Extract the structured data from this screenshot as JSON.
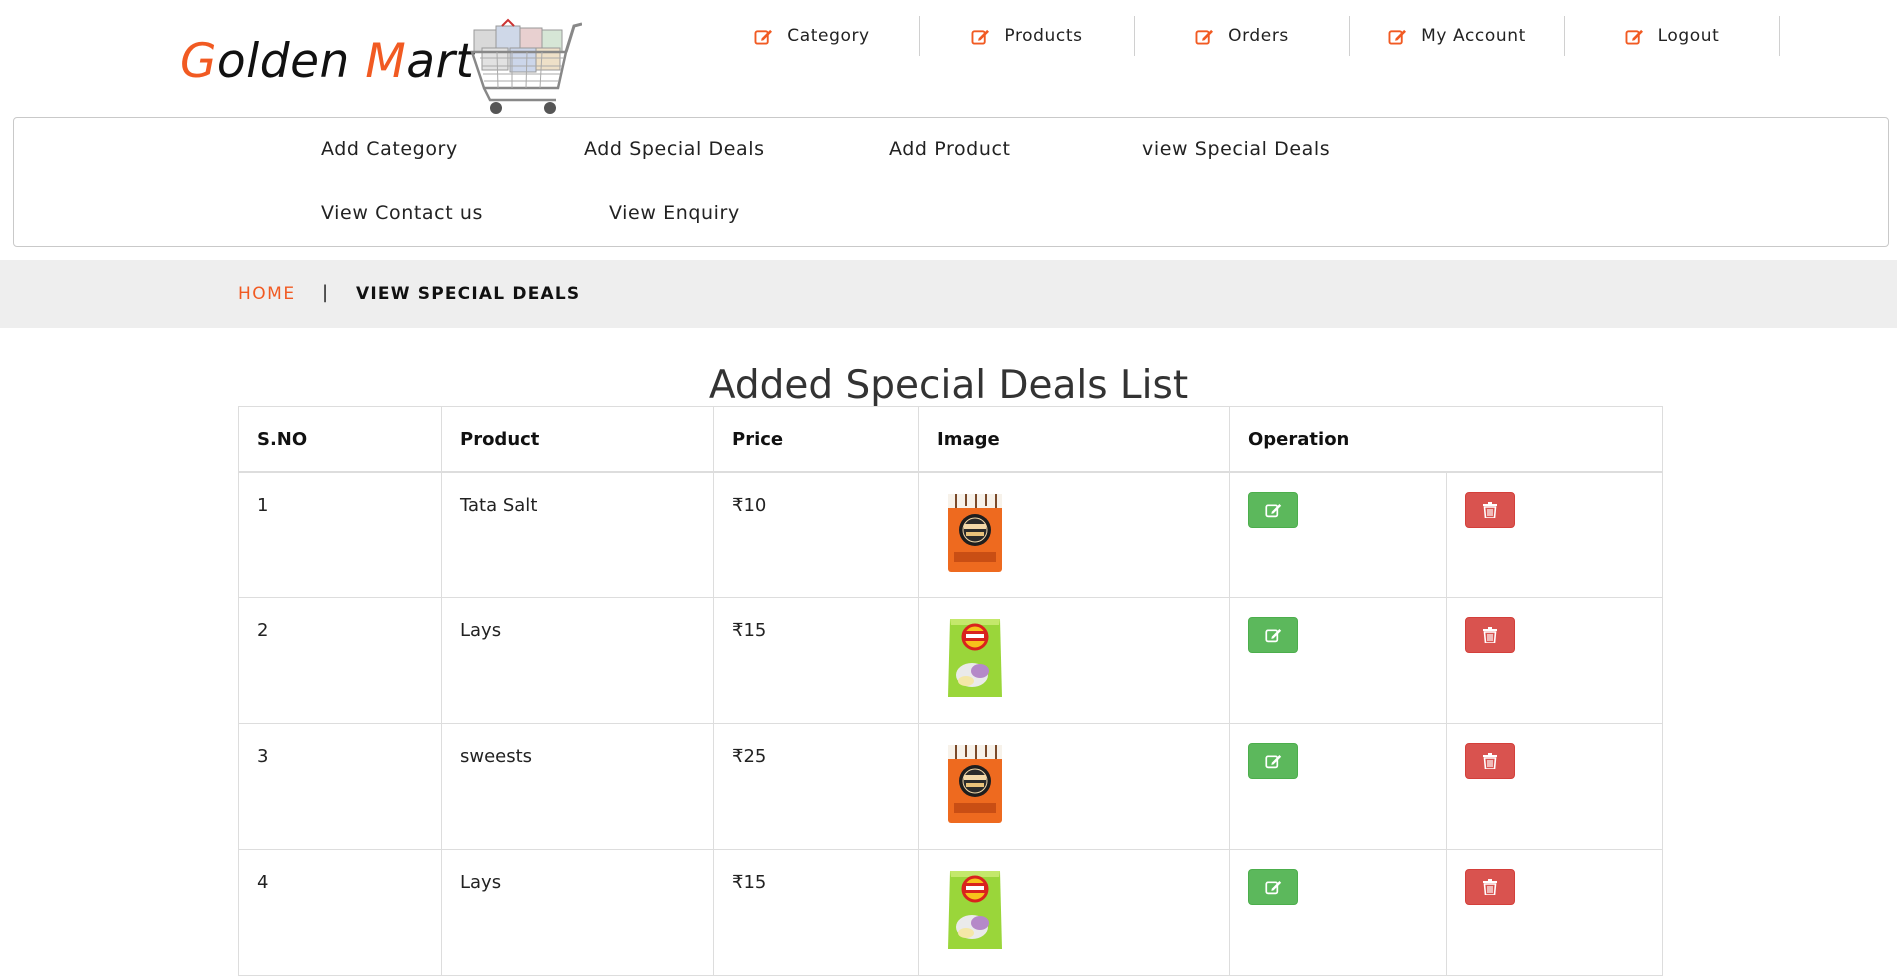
{
  "brand": {
    "g": "G",
    "olden": "olden ",
    "m": "M",
    "art": "art",
    "accent_color": "#f15a22"
  },
  "topnav": [
    {
      "label": "Category",
      "icon": "edit-icon"
    },
    {
      "label": "Products",
      "icon": "edit-icon"
    },
    {
      "label": "Orders",
      "icon": "edit-icon"
    },
    {
      "label": "My Account",
      "icon": "edit-icon"
    },
    {
      "label": "Logout",
      "icon": "edit-icon"
    }
  ],
  "submenu": {
    "add_category": "Add Category",
    "add_special_deals": "Add Special Deals",
    "add_product": "Add Product",
    "view_special_deals": "view Special Deals",
    "view_contact_us": "View Contact us",
    "view_enquiry": "View Enquiry"
  },
  "breadcrumb": {
    "home": "HOME",
    "separator": "|",
    "current": "VIEW SPECIAL DEALS"
  },
  "page_title": "Added Special Deals List",
  "table": {
    "headers": {
      "sno": "S.NO",
      "product": "Product",
      "price": "Price",
      "image": "Image",
      "operation": "Operation"
    },
    "rows": [
      {
        "sno": "1",
        "product": "Tata Salt",
        "price": "₹10",
        "image": "tata-salt-packet"
      },
      {
        "sno": "2",
        "product": "Lays",
        "price": "₹15",
        "image": "lays-chips-packet"
      },
      {
        "sno": "3",
        "product": "sweests",
        "price": "₹25",
        "image": "tata-salt-packet"
      },
      {
        "sno": "4",
        "product": "Lays",
        "price": "₹15",
        "image": "lays-chips-packet"
      }
    ]
  },
  "colors": {
    "edit_button": "#5cb85c",
    "delete_button": "#d9534f",
    "breadcrumb_bg": "#eeeeee"
  }
}
